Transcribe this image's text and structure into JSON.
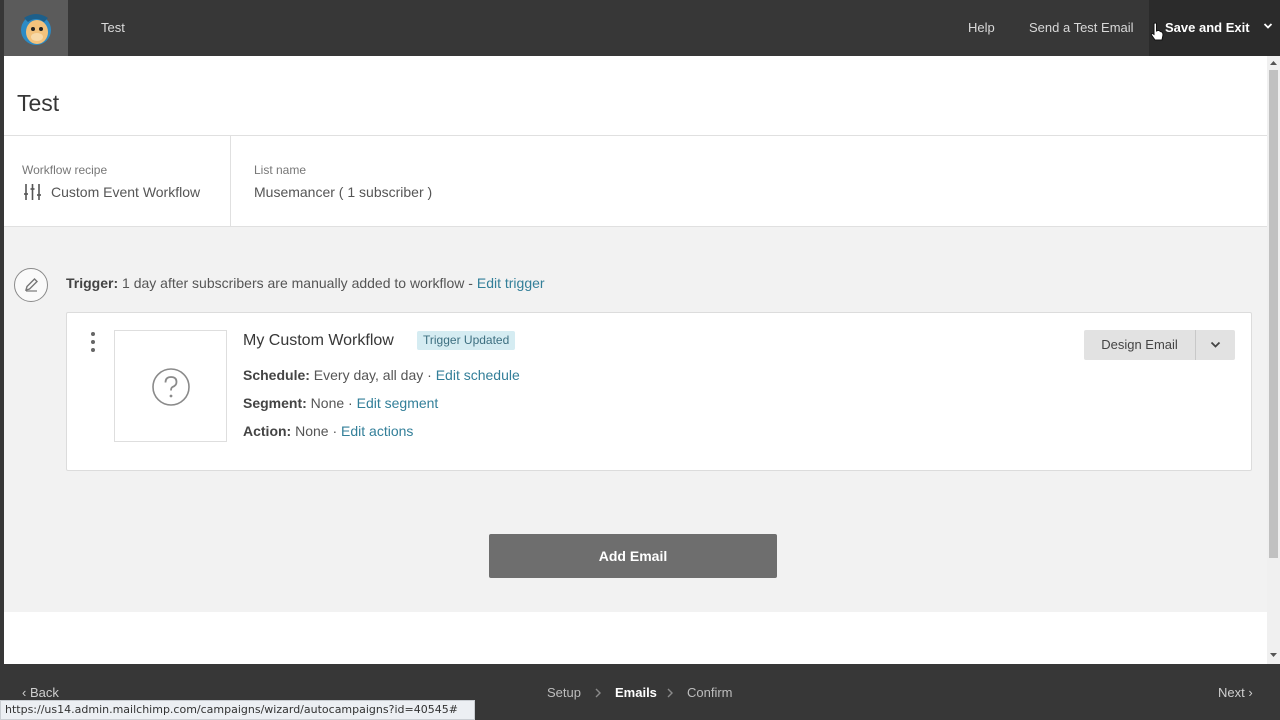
{
  "topbar": {
    "title": "Test",
    "help": "Help",
    "send_test": "Send a Test Email",
    "save_exit": "Save and Exit"
  },
  "page": {
    "title": "Test"
  },
  "meta": {
    "recipe_label": "Workflow recipe",
    "recipe_value": "Custom Event Workflow",
    "list_label": "List name",
    "list_value": "Musemancer ( 1 subscriber )"
  },
  "trigger": {
    "label": "Trigger:",
    "text": " 1 day after subscribers are manually added to workflow - ",
    "edit": "Edit trigger"
  },
  "email": {
    "name": "My Custom Workflow",
    "badge": "Trigger Updated",
    "schedule_label": "Schedule:",
    "schedule_value": " Every day, all day · ",
    "schedule_edit": "Edit schedule",
    "segment_label": "Segment:",
    "segment_value": " None · ",
    "segment_edit": "Edit segment",
    "action_label": "Action:",
    "action_value": " None · ",
    "action_edit": "Edit actions",
    "design_button": "Design Email"
  },
  "add_email": "Add Email",
  "bottombar": {
    "back": "Back",
    "next": "Next",
    "steps": [
      {
        "label": "Setup",
        "active": false
      },
      {
        "label": "Emails",
        "active": true
      },
      {
        "label": "Confirm",
        "active": false
      }
    ]
  },
  "status_url": "https://us14.admin.mailchimp.com/campaigns/wizard/autocampaigns?id=40545#",
  "colors": {
    "topbar": "#373737",
    "link": "#337f99",
    "badge_bg": "#d5ecf2",
    "add_email_bg": "#6e6e6e"
  },
  "icons": {
    "logo": "freddie-logo-icon",
    "recipe": "sliders-icon",
    "trigger": "pencil-icon",
    "thumb": "question-icon",
    "kebab": "kebab-menu-icon"
  }
}
